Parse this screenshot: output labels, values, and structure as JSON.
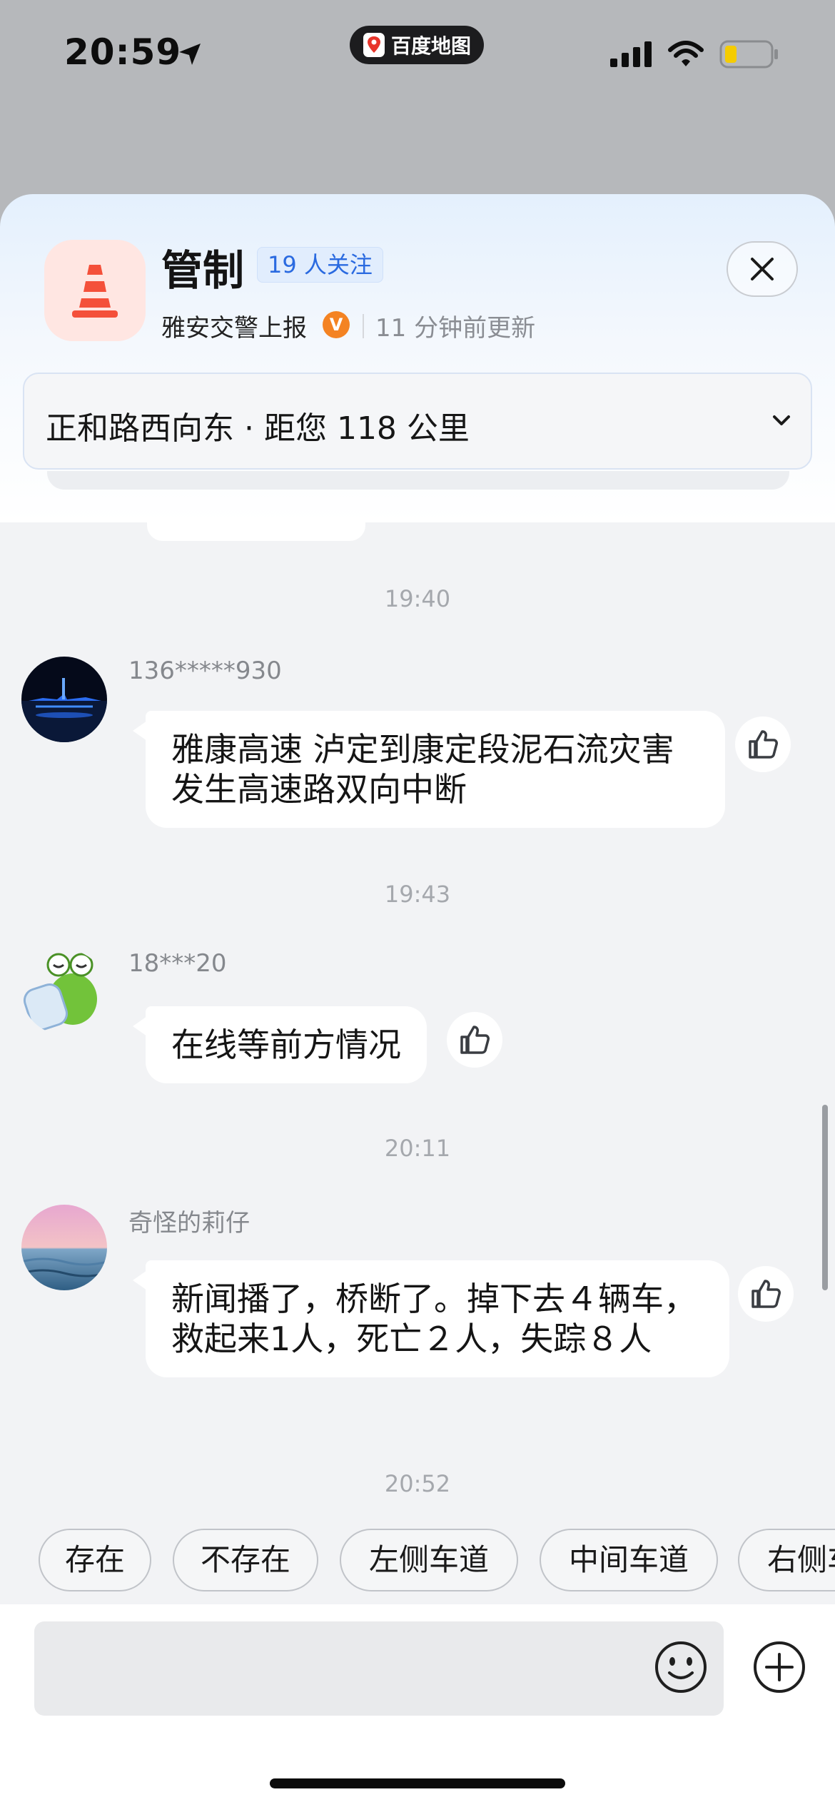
{
  "status_bar": {
    "time": "20:59",
    "app_name": "百度地图"
  },
  "card": {
    "title": "管制",
    "followers": "19 人关注",
    "source": "雅安交警上报",
    "verified_badge": "V",
    "updated": "11 分钟前更新",
    "location": "正和路西向东 · 距您 118 公里"
  },
  "messages": [
    {
      "time": "19:40",
      "user": "136*****930",
      "text": "雅康高速 泸定到康定段泥石流灾害发生高速路双向中断"
    },
    {
      "time": "19:43",
      "user": "18***20",
      "text": "在线等前方情况"
    },
    {
      "time": "20:11",
      "user": "奇怪的莉仔",
      "text": "新闻播了，桥断了。掉下去４辆车，救起来1人，死亡２人，失踪８人"
    }
  ],
  "last_time": "20:52",
  "quick_replies": [
    "存在",
    "不存在",
    "左侧车道",
    "中间车道",
    "右侧车道"
  ],
  "colors": {
    "accent_blue": "#2a6ae0",
    "cone_orange": "#f4503a",
    "verified_orange": "#f48322"
  }
}
